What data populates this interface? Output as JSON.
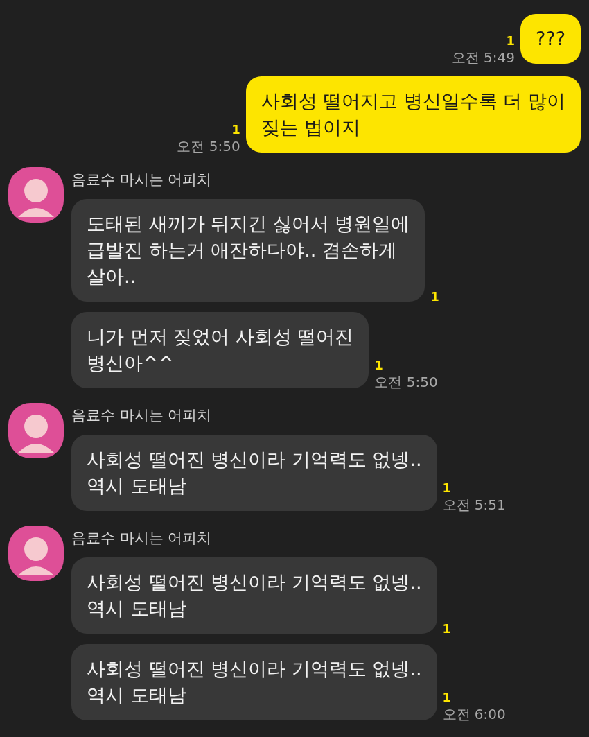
{
  "messages": [
    {
      "kind": "outgoing",
      "bubbles": [
        {
          "text": "???",
          "unread": "1",
          "time": "오전 5:49"
        }
      ]
    },
    {
      "kind": "outgoing",
      "bubbles": [
        {
          "text": "사회성 떨어지고 병신일수록 더 많이\n짖는 법이지",
          "unread": "1",
          "time": "오전 5:50"
        }
      ]
    },
    {
      "kind": "incoming",
      "sender": "음료수 마시는 어피치",
      "bubbles": [
        {
          "text": "도태된 새끼가 뒤지긴 싫어서 병원일에\n급발진 하는거 애잔하다야.. 겸손하게\n살아..",
          "unread": "1"
        },
        {
          "text": "니가 먼저 짖었어 사회성 떨어진\n병신아^^",
          "unread": "1",
          "time": "오전 5:50"
        }
      ]
    },
    {
      "kind": "incoming",
      "sender": "음료수 마시는 어피치",
      "bubbles": [
        {
          "text": "사회성 떨어진 병신이라 기억력도 없넹..\n역시 도태남",
          "unread": "1",
          "time": "오전 5:51"
        }
      ]
    },
    {
      "kind": "incoming",
      "sender": "음료수 마시는 어피치",
      "bubbles": [
        {
          "text": "사회성 떨어진 병신이라 기억력도 없넹..\n역시 도태남",
          "unread": "1"
        },
        {
          "text": "사회성 떨어진 병신이라 기억력도 없넹..\n역시 도태남",
          "unread": "1",
          "time": "오전 6:00"
        }
      ]
    }
  ]
}
